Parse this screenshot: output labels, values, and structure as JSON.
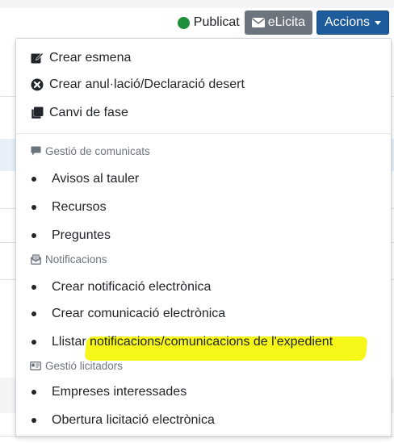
{
  "toolbar": {
    "status_label": "Publicat",
    "status_color": "#1f8f3a",
    "elicita_label": "eLicita",
    "accions_label": "Accions"
  },
  "menu": {
    "actions": [
      {
        "label": "Crear esmena",
        "icon": "edit-square-icon"
      },
      {
        "label": "Crear anul·lació/Declaració desert",
        "icon": "times-circle-icon"
      },
      {
        "label": "Canvi de fase",
        "icon": "clone-icon"
      }
    ],
    "sections": [
      {
        "header": "Gestió de comunicats",
        "icon": "comment-icon",
        "items": [
          "Avisos al tauler",
          "Recursos",
          "Preguntes"
        ]
      },
      {
        "header": "Notificacions",
        "icon": "envelope-open-text-icon",
        "items": [
          "Crear notificació electrònica",
          "Crear comunicació electrònica",
          "Llistar notificacions/comunicacions de l'expedient"
        ]
      },
      {
        "header": "Gestió licitadors",
        "icon": "id-card-icon",
        "items": [
          "Empreses interessades",
          "Obertura licitació electrònica"
        ]
      }
    ],
    "highlight_color": "#f5f500"
  }
}
